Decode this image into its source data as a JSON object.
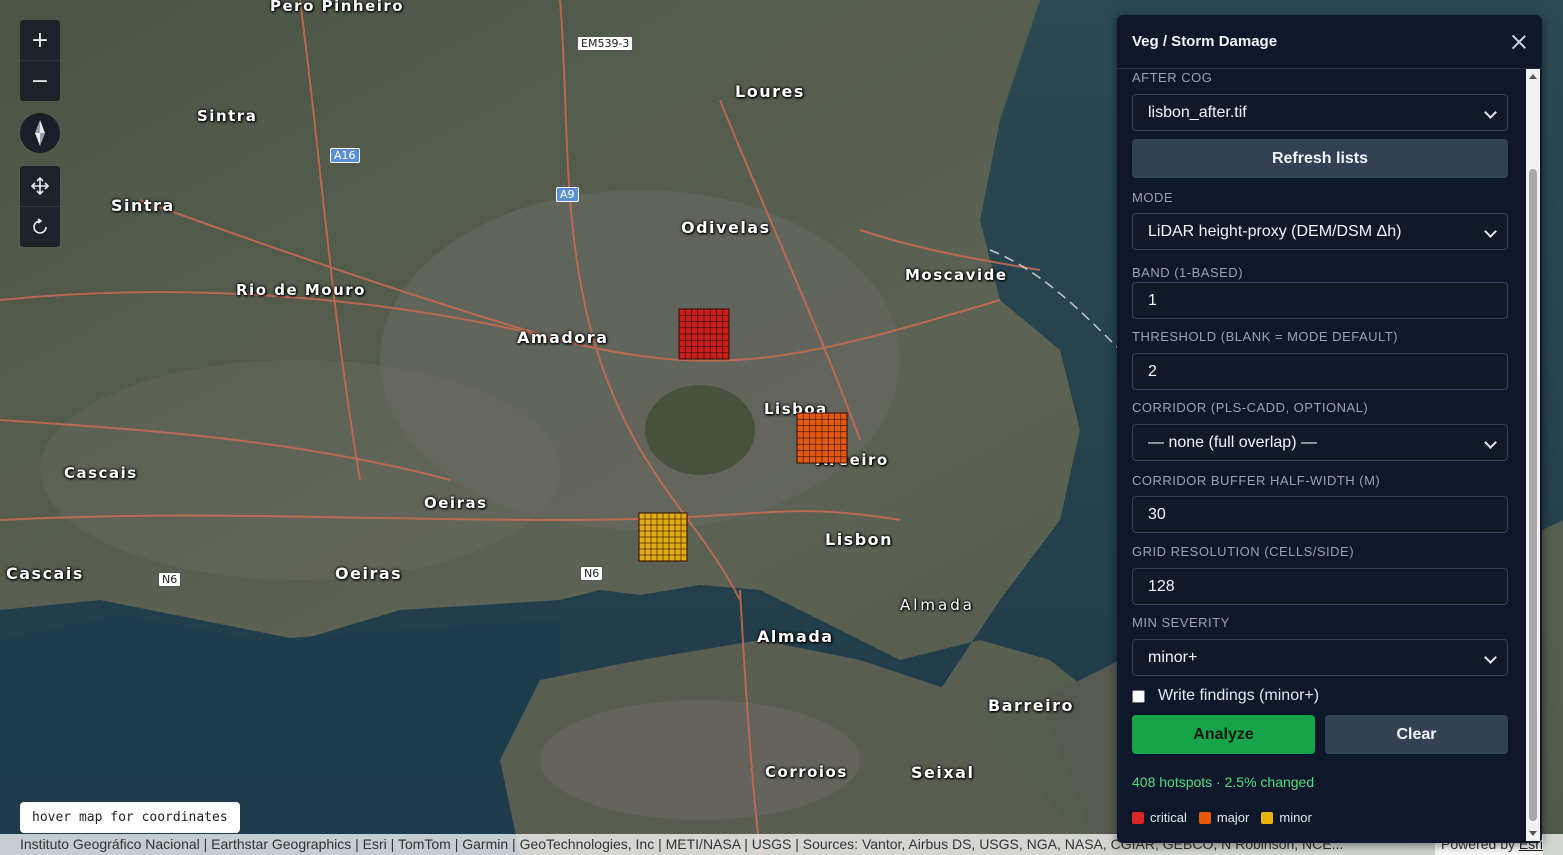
{
  "map": {
    "zoom_in": "+",
    "zoom_out": "−",
    "places": [
      {
        "id": "pero-pinheiro",
        "label": "Pero Pinheiro"
      },
      {
        "id": "em539",
        "label": "EM539-3"
      },
      {
        "id": "loures",
        "label": "Loures"
      },
      {
        "id": "sintra-1",
        "label": "Sintra"
      },
      {
        "id": "sintra-2",
        "label": "Sintra"
      },
      {
        "id": "a16",
        "label": "A16"
      },
      {
        "id": "a9",
        "label": "A9"
      },
      {
        "id": "odivelas",
        "label": "Odivelas"
      },
      {
        "id": "moscavide",
        "label": "Moscavide"
      },
      {
        "id": "rio-de-mouro",
        "label": "Rio de Mouro"
      },
      {
        "id": "amadora",
        "label": "Amadora"
      },
      {
        "id": "lisboa",
        "label": "Lisboa"
      },
      {
        "id": "areeiro",
        "label": "Areeiro"
      },
      {
        "id": "cascais-1",
        "label": "Cascais"
      },
      {
        "id": "oeiras-1",
        "label": "Oeiras"
      },
      {
        "id": "lisbon",
        "label": "Lisbon"
      },
      {
        "id": "cascais-2",
        "label": "Cascais"
      },
      {
        "id": "oeiras-2",
        "label": "Oeiras"
      },
      {
        "id": "n6-1",
        "label": "N6"
      },
      {
        "id": "n6-2",
        "label": "N6"
      },
      {
        "id": "almada-1",
        "label": "Almada"
      },
      {
        "id": "almada-2",
        "label": "Almada"
      },
      {
        "id": "barreiro",
        "label": "Barreiro"
      },
      {
        "id": "corroios",
        "label": "Corroios"
      },
      {
        "id": "seixal",
        "label": "Seixal"
      }
    ],
    "coord_hint": "hover map for coordinates",
    "attribution": "Instituto Geográfico Nacional | Earthstar Geographics | Esri | TomTom | Garmin | GeoTechnologies, Inc | METI/NASA | USGS | Sources: Vantor, Airbus DS, USGS, NGA, NASA, CGIAR, GEBCO, N Robinson, NCE...",
    "powered_by": "Powered by",
    "esri": "Esri"
  },
  "panel": {
    "title": "Veg / Storm Damage",
    "after_cog_label": "AFTER COG",
    "after_cog_value": "lisbon_after.tif",
    "refresh_label": "Refresh lists",
    "mode_label": "MODE",
    "mode_value": "LiDAR height-proxy (DEM/DSM Δh)",
    "band_label": "BAND (1-BASED)",
    "band_value": "1",
    "threshold_label": "THRESHOLD (BLANK = MODE DEFAULT)",
    "threshold_value": "2",
    "corridor_label": "CORRIDOR (PLS-CADD, OPTIONAL)",
    "corridor_value": "— none (full overlap) —",
    "buffer_label": "CORRIDOR BUFFER HALF-WIDTH (M)",
    "buffer_value": "30",
    "grid_label": "GRID RESOLUTION (CELLS/SIDE)",
    "grid_value": "128",
    "severity_label": "MIN SEVERITY",
    "severity_value": "minor+",
    "write_findings_label": "Write findings (minor+)",
    "analyze_label": "Analyze",
    "clear_label": "Clear",
    "status": "408 hotspots · 2.5% changed",
    "legend": [
      {
        "label": "critical",
        "color": "#dc2626"
      },
      {
        "label": "major",
        "color": "#ea580c"
      },
      {
        "label": "minor",
        "color": "#eab308"
      }
    ]
  },
  "hotspots": [
    {
      "severity": "critical",
      "color": "#c81e1e"
    },
    {
      "severity": "major",
      "color": "#e25a10"
    },
    {
      "severity": "minor",
      "color": "#e0ac10"
    }
  ]
}
